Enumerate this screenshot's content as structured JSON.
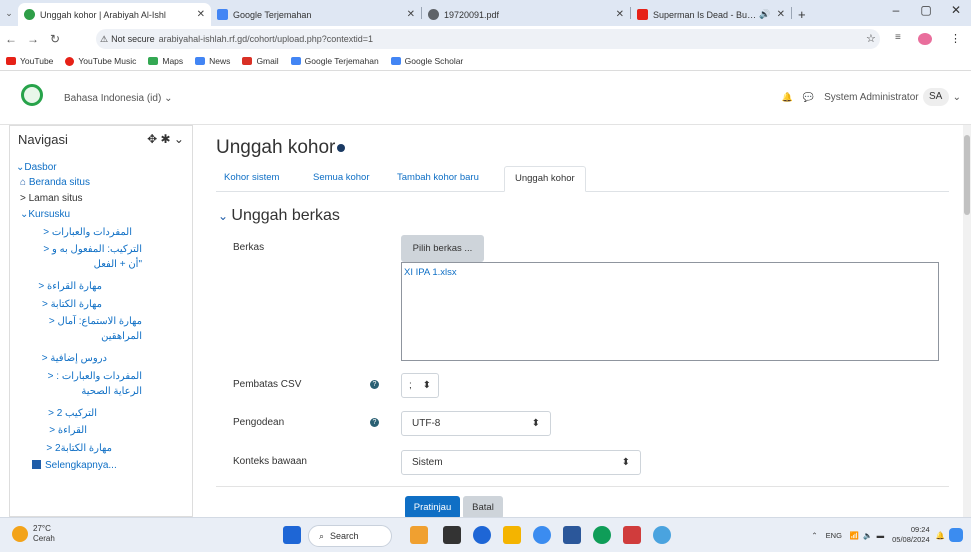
{
  "browser": {
    "tabs": [
      {
        "title": "Unggah kohor | Arabiyah Al-Ishl",
        "color": "#2e9e48"
      },
      {
        "title": "Google Terjemahan",
        "color": "#4285f4"
      },
      {
        "title": "19720091.pdf",
        "color": "#5f6368"
      },
      {
        "title": "Superman Is Dead - Bulan &",
        "color": "#e62117"
      }
    ],
    "new_tab": "+",
    "security": "Not secure",
    "url": "arabiyahal-ishlah.rf.gd/cohort/upload.php?contextid=1"
  },
  "bookmarks": [
    {
      "label": "YouTube",
      "color": "#e62117"
    },
    {
      "label": "YouTube Music",
      "color": "#e62117"
    },
    {
      "label": "Maps",
      "color": "#34a853"
    },
    {
      "label": "News",
      "color": "#4285f4"
    },
    {
      "label": "Gmail",
      "color": "#d93025"
    },
    {
      "label": "Google Terjemahan",
      "color": "#4285f4"
    },
    {
      "label": "Google Scholar",
      "color": "#4285f4"
    }
  ],
  "header": {
    "language": "Bahasa Indonesia (id) ⌄",
    "user": "System Administrator",
    "initials": "SA",
    "caret": "⌄"
  },
  "sidebar": {
    "title": "Navigasi",
    "tools": "✥ ✱ ⌄",
    "items": [
      {
        "label": "⌄Dasbor"
      },
      {
        "label": "Beranda situs"
      },
      {
        "label": "> Laman situs"
      },
      {
        "label": "⌄Kursusku"
      },
      {
        "label": "المفردات والعبارات <"
      },
      {
        "label": "التركيب: المفعول به و < \"أن + الفعل"
      },
      {
        "label": "مهارة القراءة <"
      },
      {
        "label": "مهارة الكتابة <"
      },
      {
        "label": "مهارة الاستماع: آمال < المراهقين"
      },
      {
        "label": "دروس إضافية <"
      },
      {
        "label": "المفردات والعبارات : < الرعاية الصحية"
      },
      {
        "label": "التركيب 2 <"
      },
      {
        "label": "القراءة <"
      },
      {
        "label": "مهارة الكتابة2 <"
      },
      {
        "label": "Selengkapnya..."
      }
    ]
  },
  "page": {
    "title": "Unggah kohor",
    "tabs": [
      "Kohor sistem",
      "Semua kohor",
      "Tambah kohor baru",
      "Unggah kohor"
    ],
    "section": "Unggah berkas",
    "file_label": "Berkas",
    "file_button": "Pilih berkas ...",
    "file_name": "XI IPA 1.xlsx",
    "csv_label": "Pembatas CSV",
    "csv_value": ";",
    "encoding_label": "Pengodean",
    "encoding_value": "UTF-8",
    "context_label": "Konteks bawaan",
    "context_value": "Sistem",
    "preview_button": "Pratinjau",
    "cancel_button": "Batal"
  },
  "taskbar": {
    "temp": "27°C",
    "weather": "Cerah",
    "search": "Search",
    "lang": "ENG",
    "time": "09:24",
    "date": "05/08/2024",
    "apps": [
      "#f0a030",
      "#333",
      "#1e66d6",
      "#f4b400",
      "#3b8cf0",
      "#2b579a",
      "#0f9d58",
      "#d03c3c",
      "#4aa3df"
    ]
  }
}
